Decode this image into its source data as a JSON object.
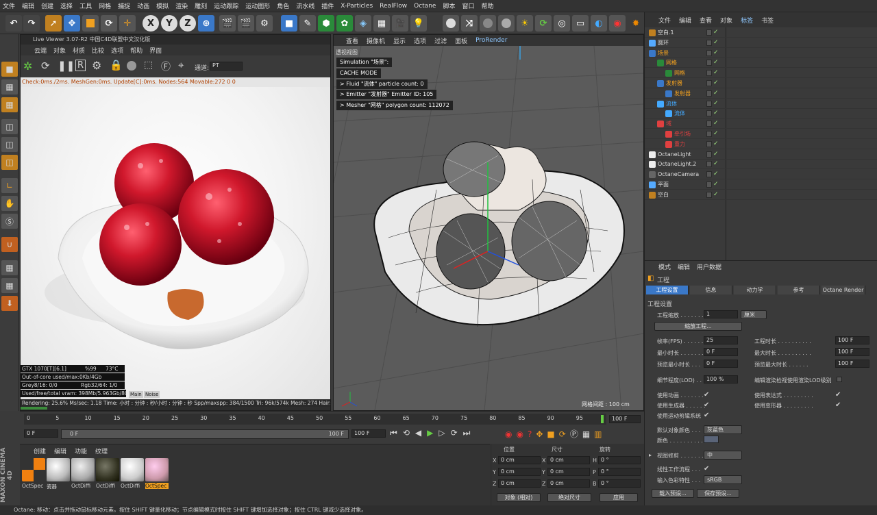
{
  "menubar": [
    "文件",
    "编辑",
    "创建",
    "选择",
    "工具",
    "网格",
    "捕捉",
    "动画",
    "模拟",
    "渲染",
    "雕刻",
    "运动跟踪",
    "运动图形",
    "角色",
    "流水线",
    "插件",
    "X-Particles",
    "RealFlow",
    "Octane",
    "脚本",
    "窗口",
    "帮助"
  ],
  "toolbar": {
    "x": "X",
    "y": "Y",
    "z": "Z"
  },
  "liveviewer": {
    "title": "Live Viewer 3.07-R2 中国C4D联盟中文汉化版",
    "menu": [
      "云端",
      "对象",
      "材质",
      "比较",
      "选项",
      "帮助",
      "界面"
    ],
    "channel_label": "通道:",
    "channel_value": "PT",
    "status": "Check:0ms./2ms. MeshGen:0ms. Update[C]:0ms. Nodes:564 Movable:272  0 0",
    "gpu": "GTX 1070[T][6.1]",
    "gpu_pct": "%99",
    "gpu_temp": "73°C",
    "outofcore": "Out-of-core used/max:0Kb/4Gb",
    "grey": "Grey8/16: 0/0",
    "rgb": "Rgb32/64: 1/0",
    "vram": "Used/free/total vram: 398Mb/5.963Gb/8Gb",
    "tab_main": "Main",
    "tab_noise": "Noise",
    "rendering": "Rendering: 25.6%  Ms/sec: 1.18  Time: 小时 : 分钟 : 秒/小时 : 分钟 : 秒  Spp/maxspp: 384/1500  Tri: 96k/574k  Mesh: 274  Hair: 0"
  },
  "viewport": {
    "menu": [
      "查看",
      "摄像机",
      "显示",
      "选项",
      "过滤",
      "面板",
      "ProRender"
    ],
    "label": "透视视图",
    "sim": [
      "Simulation \"场景\":",
      "CACHE MODE",
      "> Fluid \"流体\" particle count: 0",
      "> Emitter \"发射器\" Emitter ID: 105",
      "> Mesher \"网格\" polygon count: 112072"
    ],
    "grid": "网格间距 : 100 cm"
  },
  "timeline": {
    "ticks": [
      "0",
      "5",
      "10",
      "15",
      "20",
      "25",
      "30",
      "35",
      "40",
      "45",
      "50",
      "55",
      "60",
      "65",
      "70",
      "75",
      "80",
      "85",
      "90",
      "95"
    ],
    "end": "100 F",
    "start": "0 F",
    "cur": "0 F",
    "max": "100 F",
    "max2": "100 F"
  },
  "materials": {
    "menu": [
      "创建",
      "编辑",
      "功能",
      "纹理"
    ],
    "items": [
      "OctSpec",
      "瓷器",
      "OctDiffi",
      "OctDiffi",
      "OctDiffi",
      "OctSpec"
    ]
  },
  "coord": {
    "headers": [
      "位置",
      "尺寸",
      "旋转"
    ],
    "rows": [
      {
        "a": "X",
        "av": "0 cm",
        "b": "X",
        "bv": "0 cm",
        "c": "H",
        "cv": "0 °"
      },
      {
        "a": "Y",
        "av": "0 cm",
        "b": "Y",
        "bv": "0 cm",
        "c": "P",
        "cv": "0 °"
      },
      {
        "a": "Z",
        "av": "0 cm",
        "b": "Z",
        "bv": "0 cm",
        "c": "B",
        "cv": "0 °"
      }
    ],
    "mode1": "对象 (相对)",
    "mode2": "绝对尺寸",
    "apply": "应用"
  },
  "statusbar": "Octane:    移动：点击并拖动鼠标移动元素。按住 SHIFT 键量化移动；节点编辑模式时按住 SHIFT 键增加选择对象；按住 CTRL 键减少选择对象。",
  "objmgr": {
    "menu": [
      "文件",
      "编辑",
      "查看",
      "对象",
      "标签",
      "书签"
    ],
    "rows": [
      "空白.1",
      "圆环",
      "场景",
      "网格",
      "网格",
      "发射器",
      "发射器",
      "流体",
      "流体",
      "域",
      "牵引场",
      "重力",
      "OctaneLight",
      "OctaneLight.2",
      "OctaneCamera",
      "平面",
      "空白"
    ]
  },
  "attr": {
    "menu": [
      "模式",
      "编辑",
      "用户数据"
    ],
    "title": "工程",
    "tabs": [
      "工程设置",
      "信息",
      "动力学",
      "参考",
      "Octane Render"
    ],
    "section": "工程设置",
    "scale_label": "工程缩放 . . . . . . .",
    "scale_val": "1",
    "scale_unit": "厘米",
    "scale_btn": "缩放工程...",
    "fps_l": "帧率(FPS) . . . . . . .",
    "fps_v": "25",
    "dur_l": "工程时长 . . . . . . . . . .",
    "dur_v": "100 F",
    "mint_l": "最小时长 . . . . . . .",
    "mint_v": "0 F",
    "maxt_l": "最大时长 . . . . . . . . . .",
    "maxt_v": "100 F",
    "pmin_l": "预览最小时长 . . .",
    "pmin_v": "0 F",
    "pmax_l": "预览最大时长 . . . . . .",
    "pmax_v": "100 F",
    "lod_l": "细节程度(LOD) . . .",
    "lod_v": "100 %",
    "lod_r": "编辑渲染检视使用渲染LOD级别",
    "anim_l": "使用动画 . . . . . . .",
    "expr_l": "使用表达式 . . . . . . . . .",
    "gen_l": "使用生成器 . . . . . .",
    "def_l": "使用变形器 . . . . . . . . .",
    "motion_l": "使用运动剪辑系统",
    "defcol_l": "默认对象颜色 . . .",
    "defcol_v": "灰蓝色",
    "color_l": "颜色 . . . . . . . . . .",
    "clip_l": "视图修剪 . . . . . . .",
    "clip_v": "中",
    "linear_l": "线性工作流程 . . .",
    "incol_l": "输入色彩特性 . . .",
    "incol_v": "sRGB",
    "load_btn": "载入预设...",
    "save_btn": "保存预设..."
  }
}
